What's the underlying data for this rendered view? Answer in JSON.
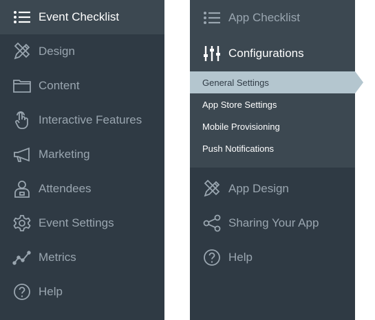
{
  "left_menu": {
    "header": {
      "label": "Event Checklist",
      "icon": "list-icon"
    },
    "items": [
      {
        "label": "Design",
        "icon": "design-tools-icon"
      },
      {
        "label": "Content",
        "icon": "folder-icon"
      },
      {
        "label": "Interactive Features",
        "icon": "touch-hand-icon"
      },
      {
        "label": "Marketing",
        "icon": "megaphone-icon"
      },
      {
        "label": "Attendees",
        "icon": "attendee-badge-icon"
      },
      {
        "label": "Event Settings",
        "icon": "gear-icon"
      },
      {
        "label": "Metrics",
        "icon": "line-chart-icon"
      },
      {
        "label": "Help",
        "icon": "help-icon"
      }
    ]
  },
  "right_menu": {
    "header": {
      "label": "App Checklist",
      "icon": "list-icon"
    },
    "configurations": {
      "label": "Configurations",
      "icon": "sliders-icon",
      "subitems": [
        {
          "label": "General Settings",
          "selected": true
        },
        {
          "label": "App Store Settings",
          "selected": false
        },
        {
          "label": "Mobile Provisioning",
          "selected": false
        },
        {
          "label": "Push Notifications",
          "selected": false
        }
      ]
    },
    "items": [
      {
        "label": "App Design",
        "icon": "design-tools-icon"
      },
      {
        "label": "Sharing Your App",
        "icon": "share-icon"
      },
      {
        "label": "Help",
        "icon": "help-icon"
      }
    ]
  },
  "colors": {
    "panel_bg": "#2f3a44",
    "header_bg": "#3c4851",
    "selected_bg": "#b4c6cf",
    "muted_text": "#9aa6b0",
    "active_text": "#ffffff"
  }
}
